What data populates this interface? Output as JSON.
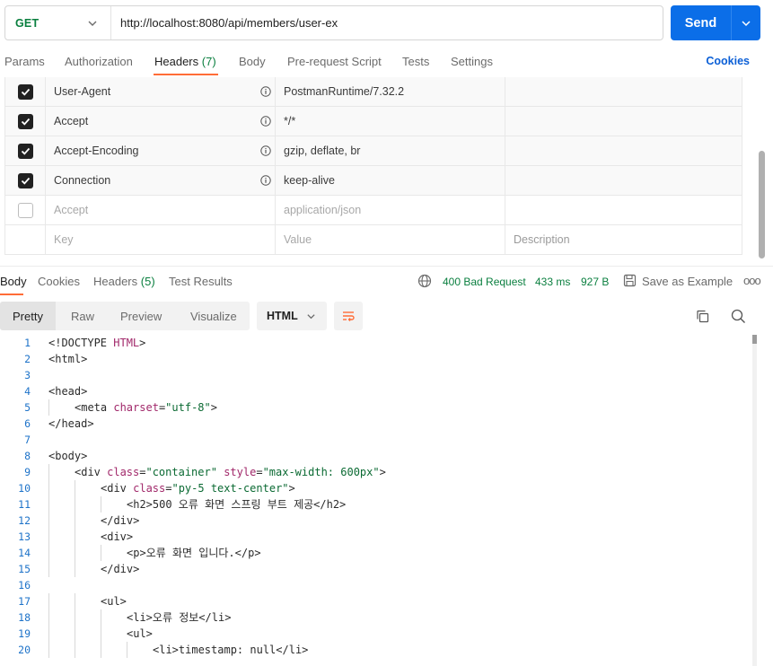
{
  "request": {
    "method": "GET",
    "url": "http://localhost:8080/api/members/user-ex",
    "send_label": "Send"
  },
  "request_tabs": {
    "params": "Params",
    "authorization": "Authorization",
    "headers": "Headers",
    "headers_count": "(7)",
    "body": "Body",
    "prerequest": "Pre-request Script",
    "tests": "Tests",
    "settings": "Settings",
    "cookies": "Cookies"
  },
  "headers": [
    {
      "checked": true,
      "key": "User-Agent",
      "value": "PostmanRuntime/7.32.2",
      "info": true
    },
    {
      "checked": true,
      "key": "Accept",
      "value": "*/*",
      "info": true
    },
    {
      "checked": true,
      "key": "Accept-Encoding",
      "value": "gzip, deflate, br",
      "info": true
    },
    {
      "checked": true,
      "key": "Connection",
      "value": "keep-alive",
      "info": true
    },
    {
      "checked": false,
      "key": "Accept",
      "value": "application/json",
      "info": false
    }
  ],
  "headers_placeholder": {
    "key": "Key",
    "value": "Value",
    "description": "Description"
  },
  "response_tabs": {
    "body": "Body",
    "cookies": "Cookies",
    "headers": "Headers",
    "headers_count": "(5)",
    "test_results": "Test Results"
  },
  "response_meta": {
    "status": "400 Bad Request",
    "time": "433 ms",
    "size": "927 B",
    "save_example": "Save as Example",
    "more": "ooo"
  },
  "format": {
    "pretty": "Pretty",
    "raw": "Raw",
    "preview": "Preview",
    "visualize": "Visualize",
    "language": "HTML"
  },
  "colors": {
    "accent": "#ff6c37",
    "send": "#0b6ee8",
    "status_green": "#0a7f3f",
    "link": "#0b5fd6"
  },
  "code_lines": [
    {
      "n": "1",
      "indent": 0,
      "parts": [
        [
          "tag",
          "<!DOCTYPE "
        ],
        [
          "attr",
          "HTML"
        ],
        [
          "tag",
          ">"
        ]
      ]
    },
    {
      "n": "2",
      "indent": 0,
      "parts": [
        [
          "tag",
          "<html>"
        ]
      ]
    },
    {
      "n": "3",
      "indent": 0,
      "parts": []
    },
    {
      "n": "4",
      "indent": 0,
      "parts": [
        [
          "tag",
          "<head>"
        ]
      ]
    },
    {
      "n": "5",
      "indent": 1,
      "parts": [
        [
          "tag",
          "<meta "
        ],
        [
          "attr",
          "charset"
        ],
        [
          "tag",
          "="
        ],
        [
          "str",
          "\"utf-8\""
        ],
        [
          "tag",
          ">"
        ]
      ]
    },
    {
      "n": "6",
      "indent": 0,
      "parts": [
        [
          "tag",
          "</head>"
        ]
      ]
    },
    {
      "n": "7",
      "indent": 0,
      "parts": []
    },
    {
      "n": "8",
      "indent": 0,
      "parts": [
        [
          "tag",
          "<body>"
        ]
      ]
    },
    {
      "n": "9",
      "indent": 1,
      "parts": [
        [
          "tag",
          "<div "
        ],
        [
          "attr",
          "class"
        ],
        [
          "tag",
          "="
        ],
        [
          "str",
          "\"container\""
        ],
        [
          "tag",
          " "
        ],
        [
          "attr",
          "style"
        ],
        [
          "tag",
          "="
        ],
        [
          "str",
          "\"max-width: 600px\""
        ],
        [
          "tag",
          ">"
        ]
      ]
    },
    {
      "n": "10",
      "indent": 2,
      "parts": [
        [
          "tag",
          "<div "
        ],
        [
          "attr",
          "class"
        ],
        [
          "tag",
          "="
        ],
        [
          "str",
          "\"py-5 text-center\""
        ],
        [
          "tag",
          ">"
        ]
      ]
    },
    {
      "n": "11",
      "indent": 3,
      "parts": [
        [
          "tag",
          "<h2>"
        ],
        [
          "tag",
          "500 오류 화면 스프링 부트 제공"
        ],
        [
          "tag",
          "</h2>"
        ]
      ]
    },
    {
      "n": "12",
      "indent": 2,
      "parts": [
        [
          "tag",
          "</div>"
        ]
      ]
    },
    {
      "n": "13",
      "indent": 2,
      "parts": [
        [
          "tag",
          "<div>"
        ]
      ]
    },
    {
      "n": "14",
      "indent": 3,
      "parts": [
        [
          "tag",
          "<p>"
        ],
        [
          "tag",
          "오류 화면 입니다."
        ],
        [
          "tag",
          "</p>"
        ]
      ]
    },
    {
      "n": "15",
      "indent": 2,
      "parts": [
        [
          "tag",
          "</div>"
        ]
      ]
    },
    {
      "n": "16",
      "indent": 0,
      "parts": []
    },
    {
      "n": "17",
      "indent": 2,
      "parts": [
        [
          "tag",
          "<ul>"
        ]
      ]
    },
    {
      "n": "18",
      "indent": 3,
      "parts": [
        [
          "tag",
          "<li>"
        ],
        [
          "tag",
          "오류 정보"
        ],
        [
          "tag",
          "</li>"
        ]
      ]
    },
    {
      "n": "19",
      "indent": 3,
      "parts": [
        [
          "tag",
          "<ul>"
        ]
      ]
    },
    {
      "n": "20",
      "indent": 4,
      "parts": [
        [
          "tag",
          "<li>"
        ],
        [
          "tag",
          "timestamp: null"
        ],
        [
          "tag",
          "</li>"
        ]
      ]
    }
  ]
}
